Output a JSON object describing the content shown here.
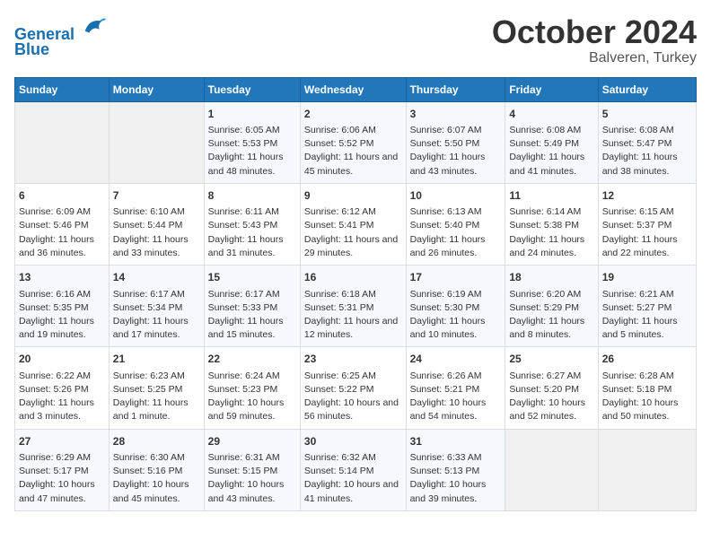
{
  "header": {
    "logo_line1": "General",
    "logo_line2": "Blue",
    "month": "October 2024",
    "location": "Balveren, Turkey"
  },
  "days_of_week": [
    "Sunday",
    "Monday",
    "Tuesday",
    "Wednesday",
    "Thursday",
    "Friday",
    "Saturday"
  ],
  "weeks": [
    [
      {
        "day": "",
        "info": ""
      },
      {
        "day": "",
        "info": ""
      },
      {
        "day": "1",
        "info": "Sunrise: 6:05 AM\nSunset: 5:53 PM\nDaylight: 11 hours and 48 minutes."
      },
      {
        "day": "2",
        "info": "Sunrise: 6:06 AM\nSunset: 5:52 PM\nDaylight: 11 hours and 45 minutes."
      },
      {
        "day": "3",
        "info": "Sunrise: 6:07 AM\nSunset: 5:50 PM\nDaylight: 11 hours and 43 minutes."
      },
      {
        "day": "4",
        "info": "Sunrise: 6:08 AM\nSunset: 5:49 PM\nDaylight: 11 hours and 41 minutes."
      },
      {
        "day": "5",
        "info": "Sunrise: 6:08 AM\nSunset: 5:47 PM\nDaylight: 11 hours and 38 minutes."
      }
    ],
    [
      {
        "day": "6",
        "info": "Sunrise: 6:09 AM\nSunset: 5:46 PM\nDaylight: 11 hours and 36 minutes."
      },
      {
        "day": "7",
        "info": "Sunrise: 6:10 AM\nSunset: 5:44 PM\nDaylight: 11 hours and 33 minutes."
      },
      {
        "day": "8",
        "info": "Sunrise: 6:11 AM\nSunset: 5:43 PM\nDaylight: 11 hours and 31 minutes."
      },
      {
        "day": "9",
        "info": "Sunrise: 6:12 AM\nSunset: 5:41 PM\nDaylight: 11 hours and 29 minutes."
      },
      {
        "day": "10",
        "info": "Sunrise: 6:13 AM\nSunset: 5:40 PM\nDaylight: 11 hours and 26 minutes."
      },
      {
        "day": "11",
        "info": "Sunrise: 6:14 AM\nSunset: 5:38 PM\nDaylight: 11 hours and 24 minutes."
      },
      {
        "day": "12",
        "info": "Sunrise: 6:15 AM\nSunset: 5:37 PM\nDaylight: 11 hours and 22 minutes."
      }
    ],
    [
      {
        "day": "13",
        "info": "Sunrise: 6:16 AM\nSunset: 5:35 PM\nDaylight: 11 hours and 19 minutes."
      },
      {
        "day": "14",
        "info": "Sunrise: 6:17 AM\nSunset: 5:34 PM\nDaylight: 11 hours and 17 minutes."
      },
      {
        "day": "15",
        "info": "Sunrise: 6:17 AM\nSunset: 5:33 PM\nDaylight: 11 hours and 15 minutes."
      },
      {
        "day": "16",
        "info": "Sunrise: 6:18 AM\nSunset: 5:31 PM\nDaylight: 11 hours and 12 minutes."
      },
      {
        "day": "17",
        "info": "Sunrise: 6:19 AM\nSunset: 5:30 PM\nDaylight: 11 hours and 10 minutes."
      },
      {
        "day": "18",
        "info": "Sunrise: 6:20 AM\nSunset: 5:29 PM\nDaylight: 11 hours and 8 minutes."
      },
      {
        "day": "19",
        "info": "Sunrise: 6:21 AM\nSunset: 5:27 PM\nDaylight: 11 hours and 5 minutes."
      }
    ],
    [
      {
        "day": "20",
        "info": "Sunrise: 6:22 AM\nSunset: 5:26 PM\nDaylight: 11 hours and 3 minutes."
      },
      {
        "day": "21",
        "info": "Sunrise: 6:23 AM\nSunset: 5:25 PM\nDaylight: 11 hours and 1 minute."
      },
      {
        "day": "22",
        "info": "Sunrise: 6:24 AM\nSunset: 5:23 PM\nDaylight: 10 hours and 59 minutes."
      },
      {
        "day": "23",
        "info": "Sunrise: 6:25 AM\nSunset: 5:22 PM\nDaylight: 10 hours and 56 minutes."
      },
      {
        "day": "24",
        "info": "Sunrise: 6:26 AM\nSunset: 5:21 PM\nDaylight: 10 hours and 54 minutes."
      },
      {
        "day": "25",
        "info": "Sunrise: 6:27 AM\nSunset: 5:20 PM\nDaylight: 10 hours and 52 minutes."
      },
      {
        "day": "26",
        "info": "Sunrise: 6:28 AM\nSunset: 5:18 PM\nDaylight: 10 hours and 50 minutes."
      }
    ],
    [
      {
        "day": "27",
        "info": "Sunrise: 6:29 AM\nSunset: 5:17 PM\nDaylight: 10 hours and 47 minutes."
      },
      {
        "day": "28",
        "info": "Sunrise: 6:30 AM\nSunset: 5:16 PM\nDaylight: 10 hours and 45 minutes."
      },
      {
        "day": "29",
        "info": "Sunrise: 6:31 AM\nSunset: 5:15 PM\nDaylight: 10 hours and 43 minutes."
      },
      {
        "day": "30",
        "info": "Sunrise: 6:32 AM\nSunset: 5:14 PM\nDaylight: 10 hours and 41 minutes."
      },
      {
        "day": "31",
        "info": "Sunrise: 6:33 AM\nSunset: 5:13 PM\nDaylight: 10 hours and 39 minutes."
      },
      {
        "day": "",
        "info": ""
      },
      {
        "day": "",
        "info": ""
      }
    ]
  ]
}
